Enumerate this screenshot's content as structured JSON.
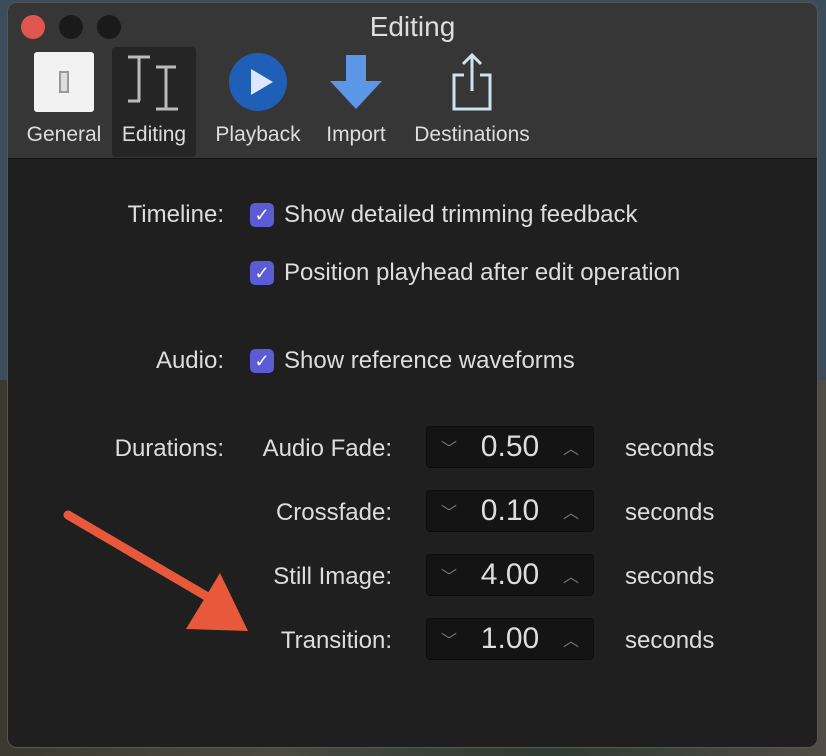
{
  "window": {
    "title": "Editing"
  },
  "toolbar": {
    "items": [
      {
        "label": "General"
      },
      {
        "label": "Editing",
        "selected": true
      },
      {
        "label": "Playback"
      },
      {
        "label": "Import"
      },
      {
        "label": "Destinations"
      }
    ]
  },
  "timeline": {
    "label": "Timeline:",
    "options": [
      {
        "label": "Show detailed trimming feedback",
        "checked": true
      },
      {
        "label": "Position playhead after edit operation",
        "checked": true
      }
    ]
  },
  "audio": {
    "label": "Audio:",
    "options": [
      {
        "label": "Show reference waveforms",
        "checked": true
      }
    ]
  },
  "durations": {
    "label": "Durations:",
    "unit": "seconds",
    "rows": [
      {
        "label": "Audio Fade:",
        "value": "0.50"
      },
      {
        "label": "Crossfade:",
        "value": "0.10"
      },
      {
        "label": "Still Image:",
        "value": "4.00"
      },
      {
        "label": "Transition:",
        "value": "1.00"
      }
    ]
  },
  "colors": {
    "accent": "#5b5bd6",
    "annotation_arrow": "#e8583a",
    "close": "#e0564e"
  }
}
